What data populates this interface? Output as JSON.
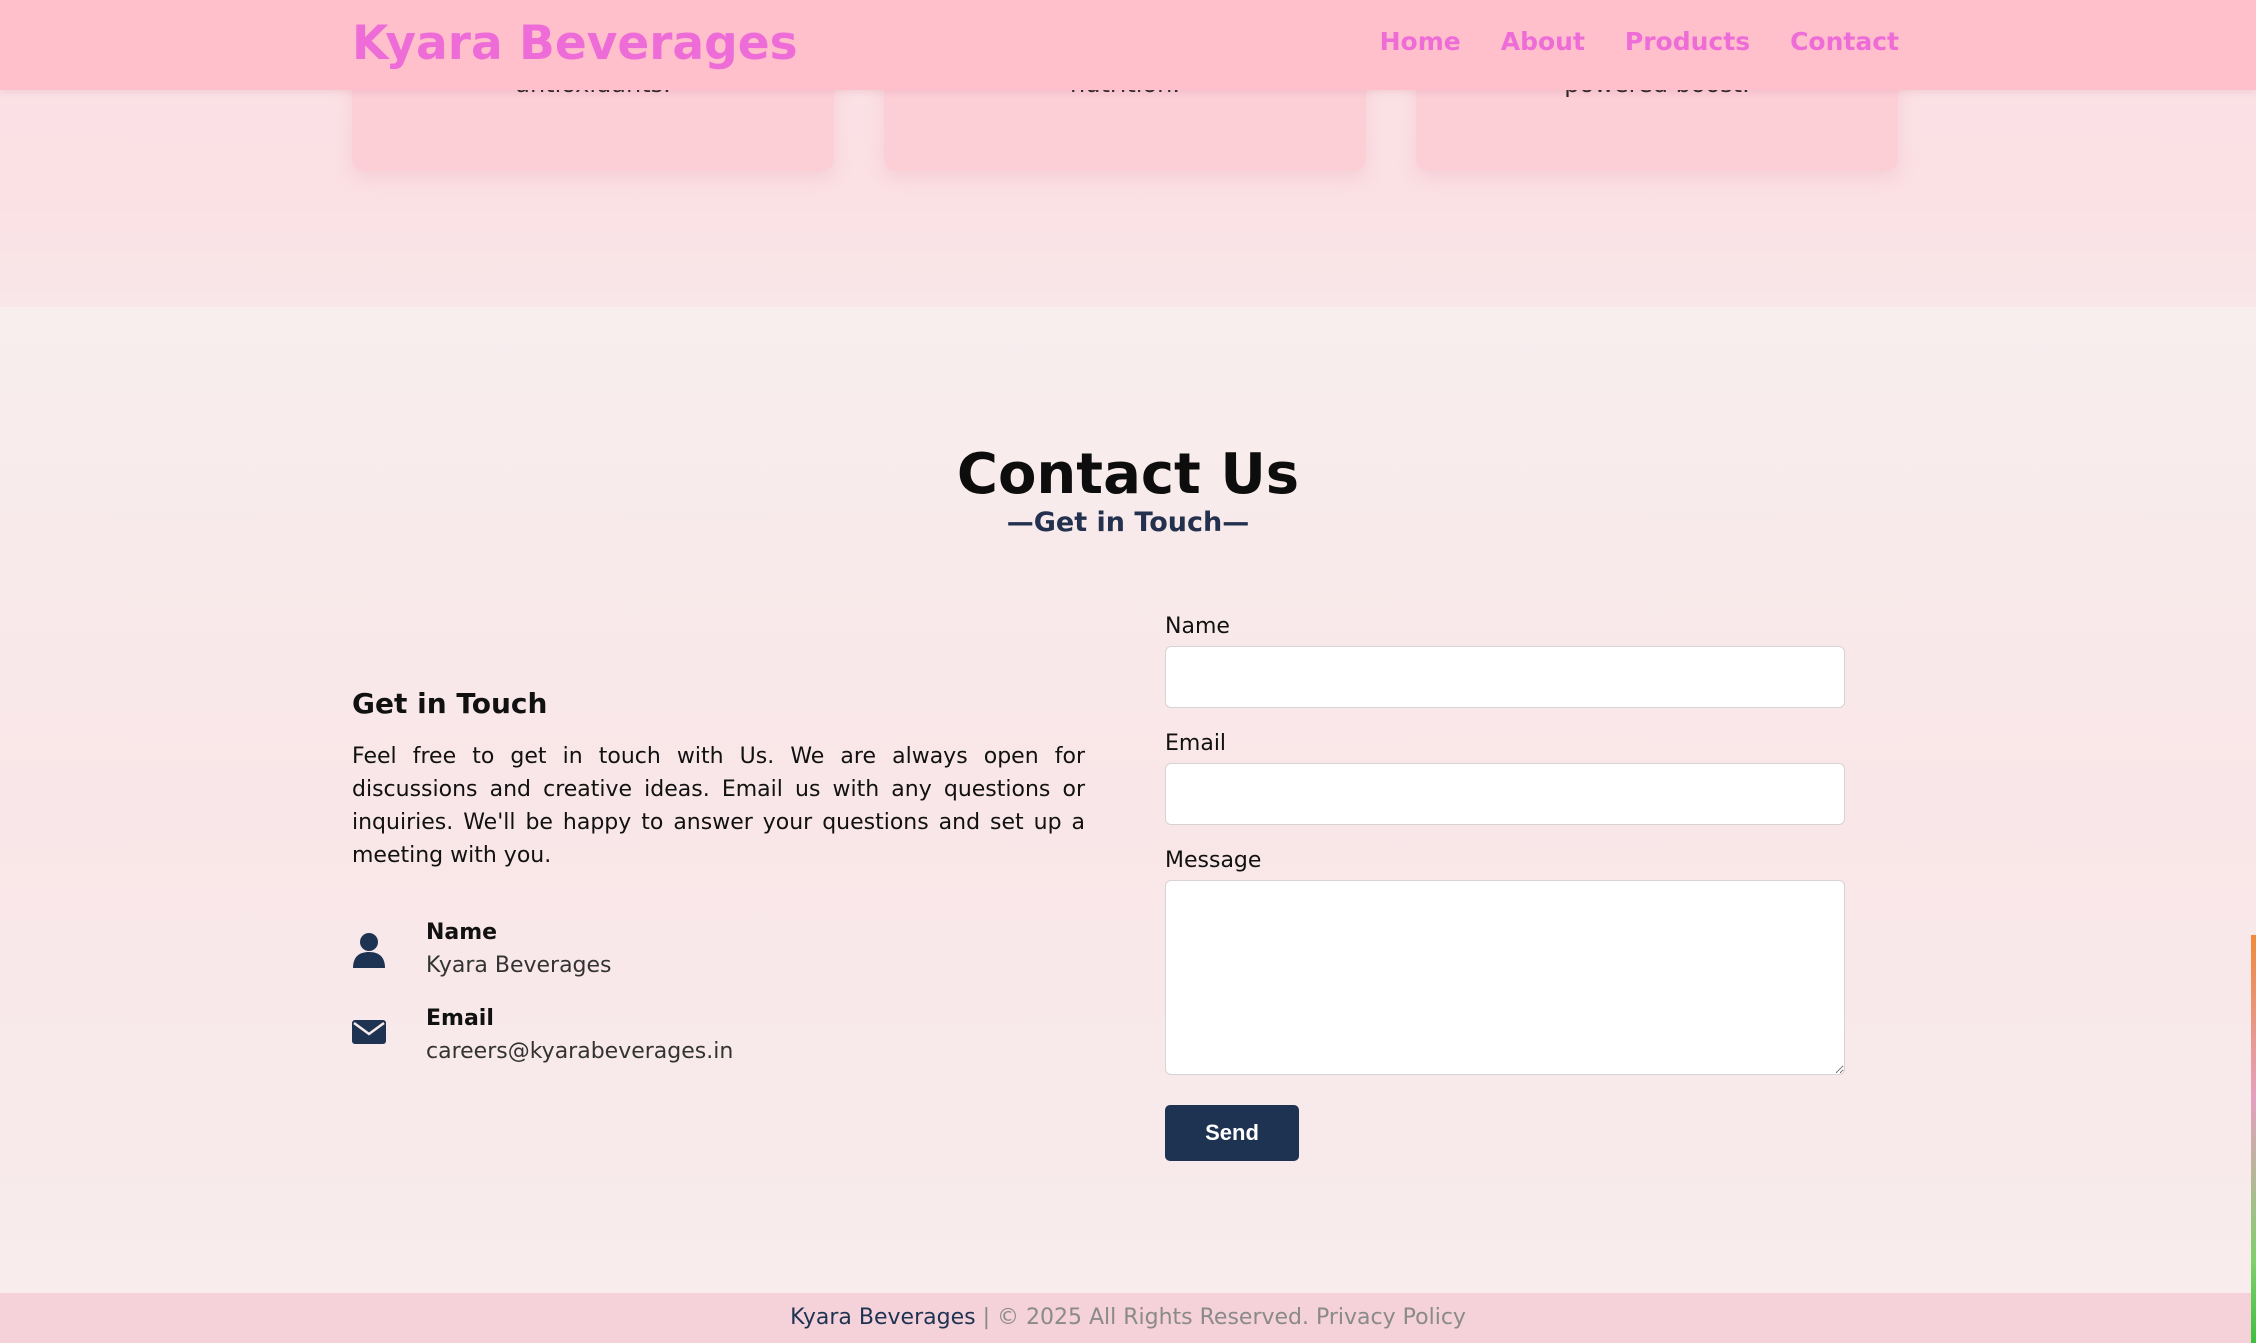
{
  "brand": "Kyara Beverages",
  "nav": {
    "links": [
      "Home",
      "About",
      "Products",
      "Contact"
    ]
  },
  "products": {
    "cards": [
      {
        "text": "antioxidants."
      },
      {
        "text": "nutrition."
      },
      {
        "text": "powered boost."
      }
    ]
  },
  "contact": {
    "title": "Contact Us",
    "subtitle": "—Get in Touch—",
    "info": {
      "heading": "Get in Touch",
      "body": "Feel free to get in touch with Us. We are always open for discussions and creative ideas. Email us with any questions or inquiries. We'll be happy to answer your questions and set up a meeting with you.",
      "items": [
        {
          "label": "Name",
          "value": "Kyara Beverages",
          "icon": "user-icon"
        },
        {
          "label": "Email",
          "value": "careers@kyarabeverages.in",
          "icon": "envelope-icon"
        }
      ]
    },
    "form": {
      "name_label": "Name",
      "name_value": "",
      "email_label": "Email",
      "email_value": "",
      "message_label": "Message",
      "message_value": "",
      "send_label": "Send"
    }
  },
  "footer": {
    "brand": "Kyara Beverages",
    "rest": " | © 2025 All Rights Reserved. Privacy Policy"
  },
  "colors": {
    "brand": "#ee6cd8",
    "navbar": "#ffbfcb",
    "accent": "#1e3352"
  }
}
